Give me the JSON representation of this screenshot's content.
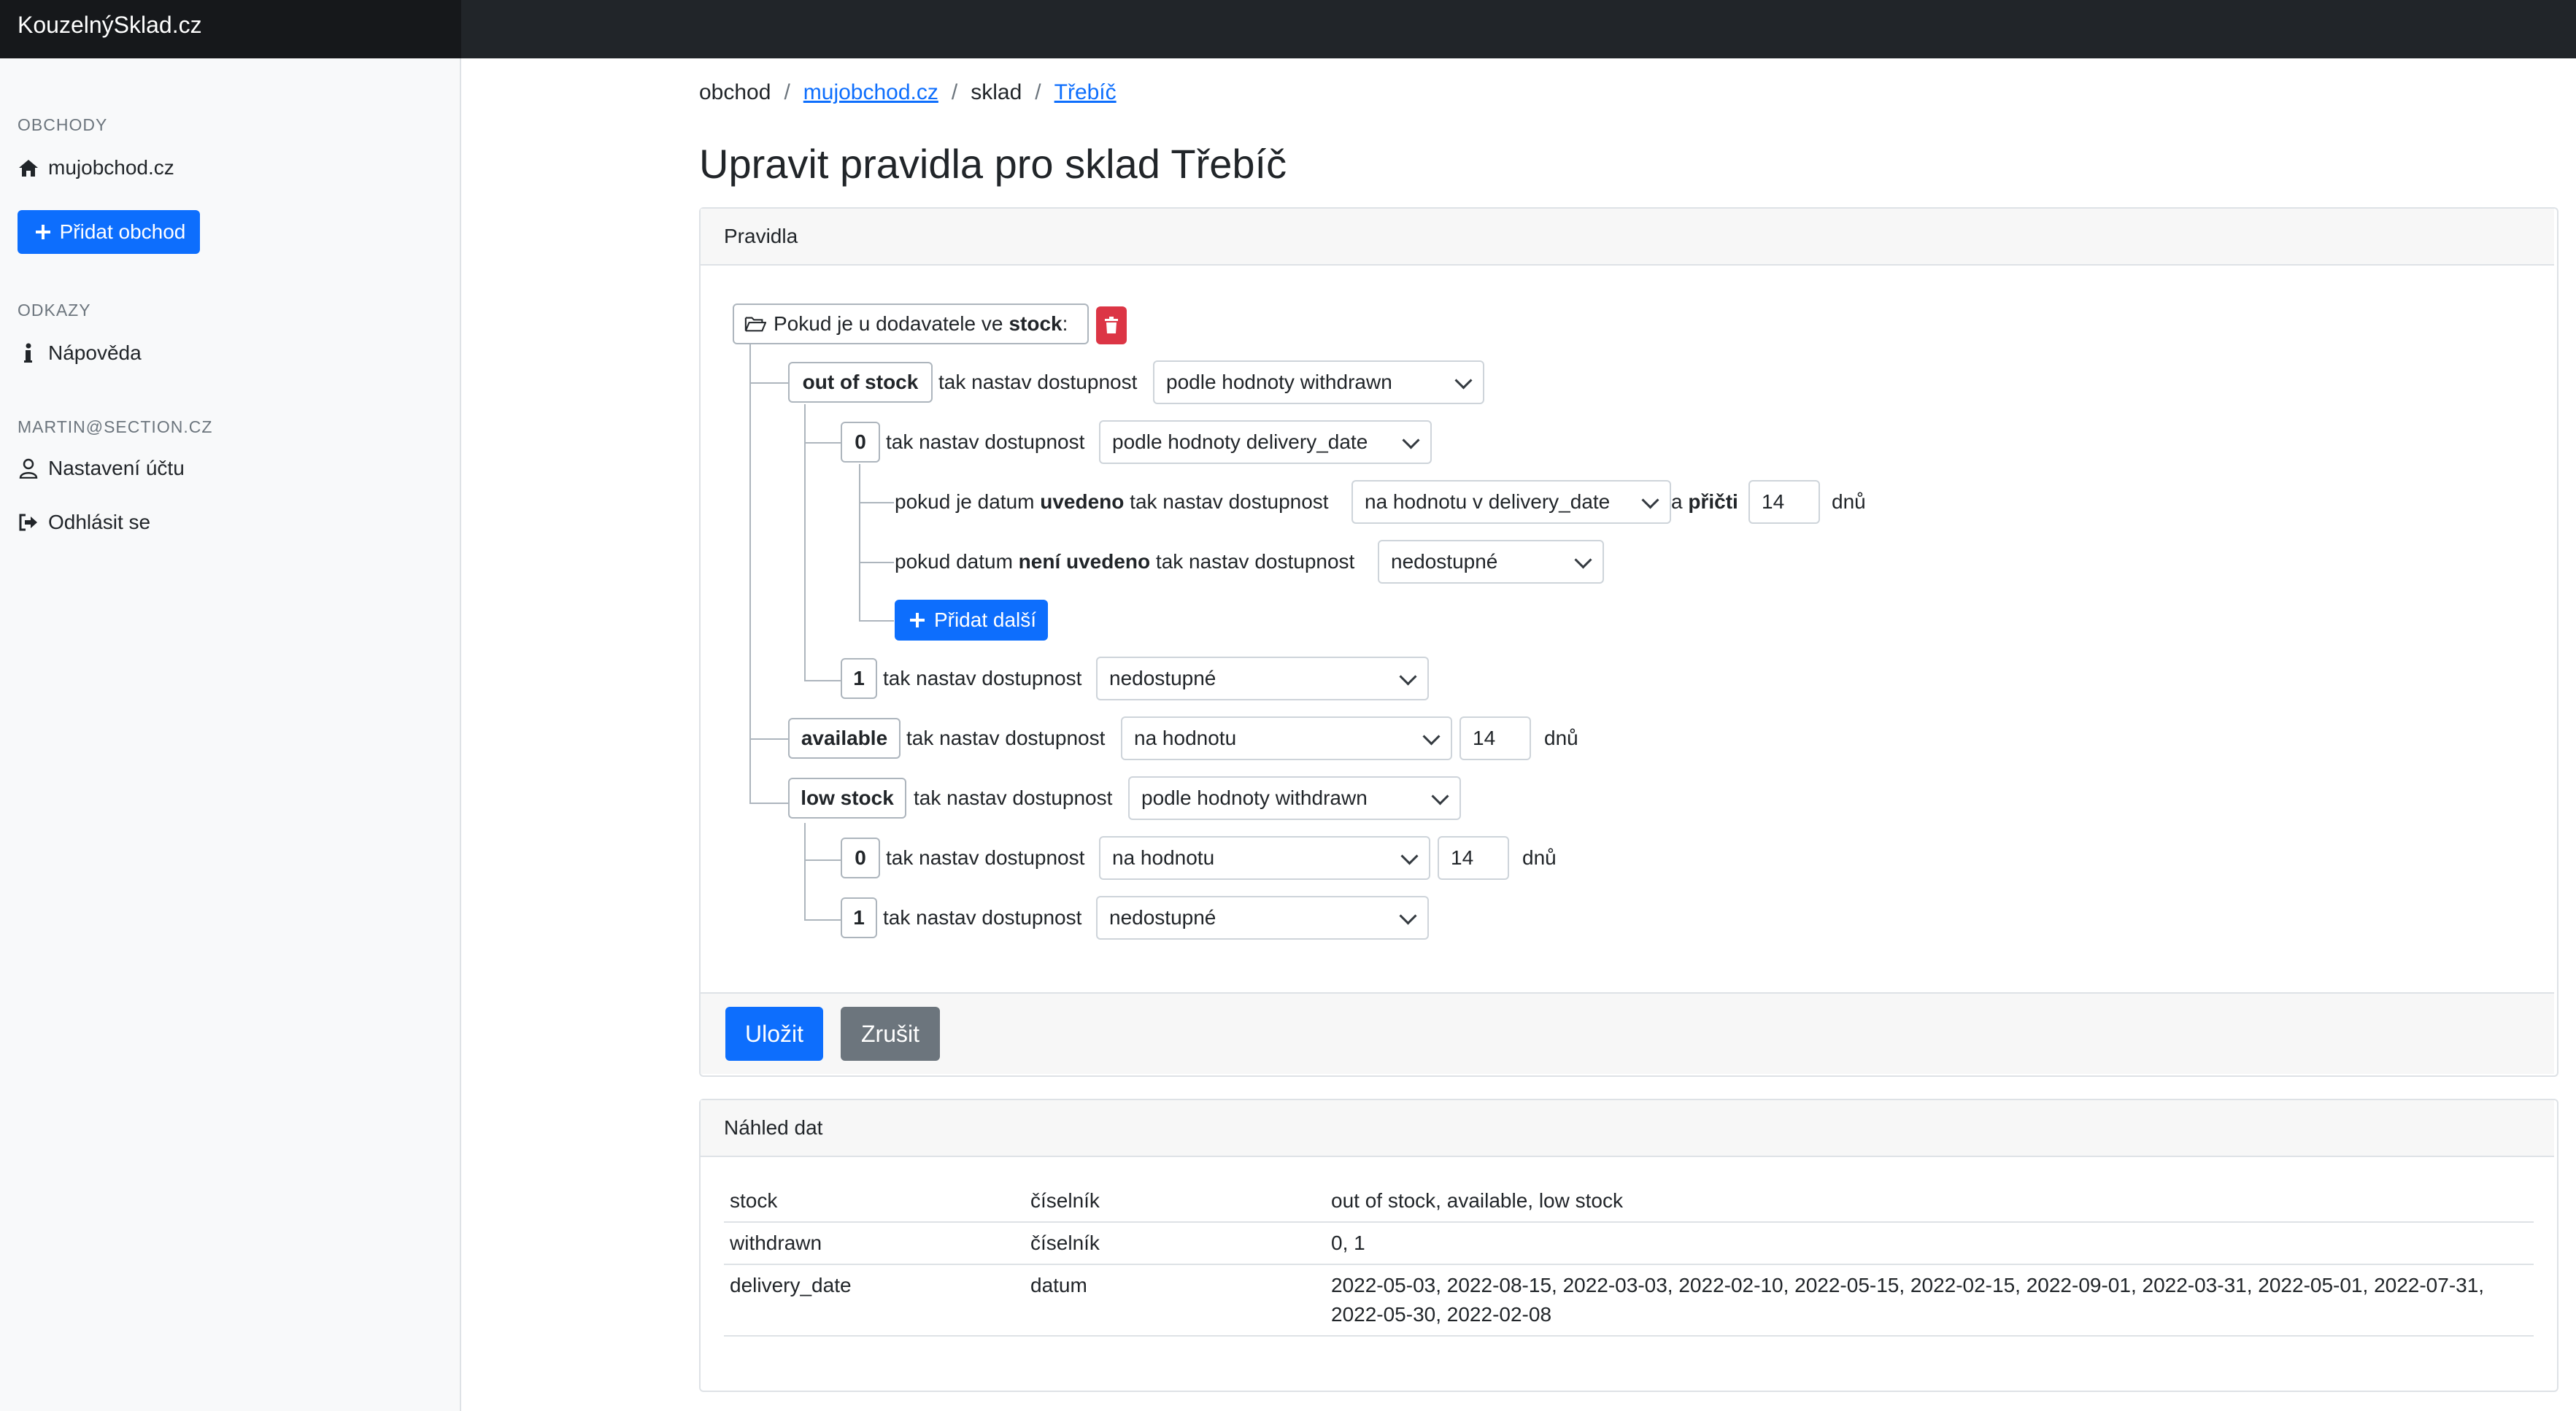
{
  "app": {
    "title": "KouzelnýSklad.cz"
  },
  "sidebar": {
    "shops_heading": "OBCHODY",
    "shop_name": "mujobchod.cz",
    "add_shop_label": "Přidat obchod",
    "links_heading": "ODKAZY",
    "help_label": "Nápověda",
    "user_heading": "MARTIN@SECTION.CZ",
    "account_label": "Nastavení účtu",
    "logout_label": "Odhlásit se"
  },
  "breadcrumb": {
    "shop": "obchod",
    "shop_link": "mujobchod.cz",
    "warehouse": "sklad",
    "warehouse_link": "Třebíč"
  },
  "page": {
    "title": "Upravit pravidla pro sklad Třebíč"
  },
  "rules": {
    "card_title": "Pravidla",
    "root_prefix": "Pokud je u dodavatele ve",
    "root_field": "stock",
    "root_suffix": ":",
    "set_text": "tak nastav dostupnost",
    "out_of_stock": {
      "label": "out of stock",
      "select": "podle hodnoty withdrawn",
      "zero": {
        "label": "0",
        "select": "podle hodnoty delivery_date",
        "date_given_pre": "pokud je datum",
        "date_given_bold": "uvedeno",
        "date_given_post": "tak nastav dostupnost",
        "date_given_select": "na hodnotu v delivery_date",
        "add_pre": "a",
        "add_bold": "přičti",
        "add_value": "14",
        "days": "dnů",
        "date_missing_pre": "pokud datum",
        "date_missing_bold": "není uvedeno",
        "date_missing_post": "tak nastav dostupnost",
        "date_missing_select": "nedostupné",
        "add_more_label": "Přidat další"
      },
      "one": {
        "label": "1",
        "select": "nedostupné"
      }
    },
    "available": {
      "label": "available",
      "select": "na hodnotu",
      "value": "14",
      "days": "dnů"
    },
    "low_stock": {
      "label": "low stock",
      "select": "podle hodnoty withdrawn",
      "zero": {
        "label": "0",
        "select": "na hodnotu",
        "value": "14",
        "days": "dnů"
      },
      "one": {
        "label": "1",
        "select": "nedostupné"
      }
    },
    "save_label": "Uložit",
    "cancel_label": "Zrušit"
  },
  "preview": {
    "card_title": "Náhled dat",
    "rows": [
      {
        "name": "stock",
        "type": "číselník",
        "values": "out of stock, available, low stock"
      },
      {
        "name": "withdrawn",
        "type": "číselník",
        "values": "0, 1"
      },
      {
        "name": "delivery_date",
        "type": "datum",
        "values": "2022-05-03, 2022-08-15, 2022-03-03, 2022-02-10, 2022-05-15, 2022-02-15, 2022-09-01, 2022-03-31, 2022-05-01, 2022-07-31, 2022-05-30, 2022-02-08"
      }
    ]
  },
  "colors": {
    "primary": "#0d6efd",
    "danger": "#dc3545",
    "secondary": "#6c757d",
    "topbar": "#212529"
  }
}
